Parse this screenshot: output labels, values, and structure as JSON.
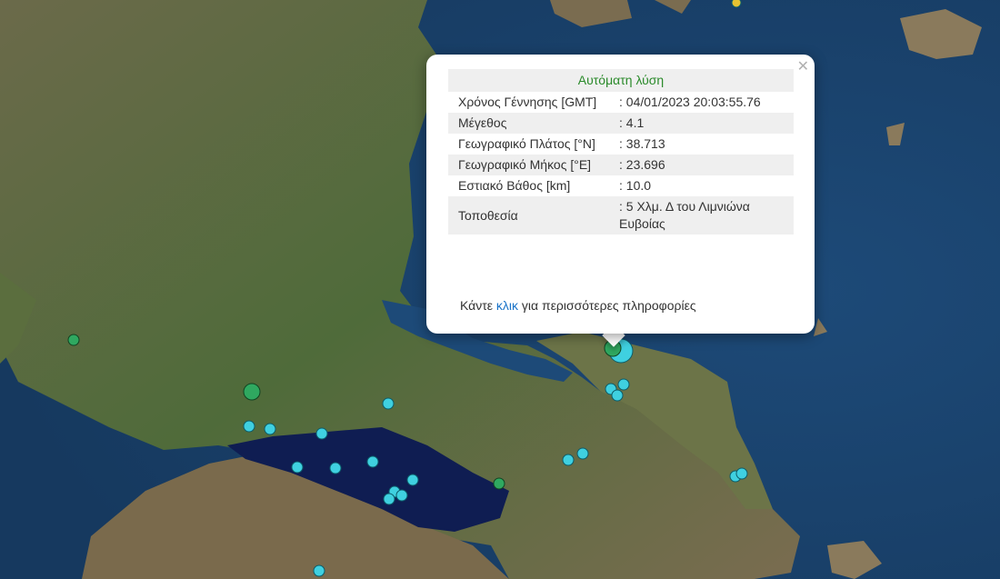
{
  "popup": {
    "title": "Αυτόματη λύση",
    "close_icon": "close-icon",
    "rows": [
      {
        "label": "Χρόνος Γέννησης [GMT]",
        "value": ": 04/01/2023 20:03:55.76"
      },
      {
        "label": "Μέγεθος",
        "value": ": 4.1"
      },
      {
        "label": "Γεωγραφικό Πλάτος [°N]",
        "value": ": 38.713"
      },
      {
        "label": "Γεωγραφικό Μήκος [°E]",
        "value": ": 23.696"
      },
      {
        "label": "Εστιακό Βάθος [km]",
        "value": ": 10.0"
      },
      {
        "label": "Τοποθεσία",
        "value": ": 5 Χλμ. Δ του Λιμνιώνα Ευβοίας"
      }
    ],
    "more_prefix": "Κάντε ",
    "more_link": "κλικ",
    "more_suffix": " για περισσότερες πληροφορίες"
  },
  "colors": {
    "sea_deep": "#12305a",
    "sea": "#1d4a78",
    "gulf": "#0f1d52",
    "land_green": "#4f6b3a",
    "land_brown": "#8a7a5c",
    "marker_cyan": "#3fd0e0",
    "marker_green": "#2fa860",
    "marker_yellow": "#e6c232"
  },
  "markers": [
    {
      "type": "cyan",
      "magnitude": 4.1,
      "selected": true
    },
    {
      "type": "green"
    },
    {
      "type": "green"
    },
    {
      "type": "green"
    },
    {
      "type": "green"
    },
    {
      "type": "cyan"
    },
    {
      "type": "cyan"
    },
    {
      "type": "cyan"
    },
    {
      "type": "cyan"
    },
    {
      "type": "cyan"
    },
    {
      "type": "cyan"
    },
    {
      "type": "cyan"
    },
    {
      "type": "cyan"
    },
    {
      "type": "cyan"
    },
    {
      "type": "cyan"
    },
    {
      "type": "cyan"
    },
    {
      "type": "cyan"
    },
    {
      "type": "cyan"
    },
    {
      "type": "cyan"
    },
    {
      "type": "cyan"
    },
    {
      "type": "cyan"
    },
    {
      "type": "cyan"
    },
    {
      "type": "cyan"
    },
    {
      "type": "cyan"
    },
    {
      "type": "yellow"
    }
  ]
}
